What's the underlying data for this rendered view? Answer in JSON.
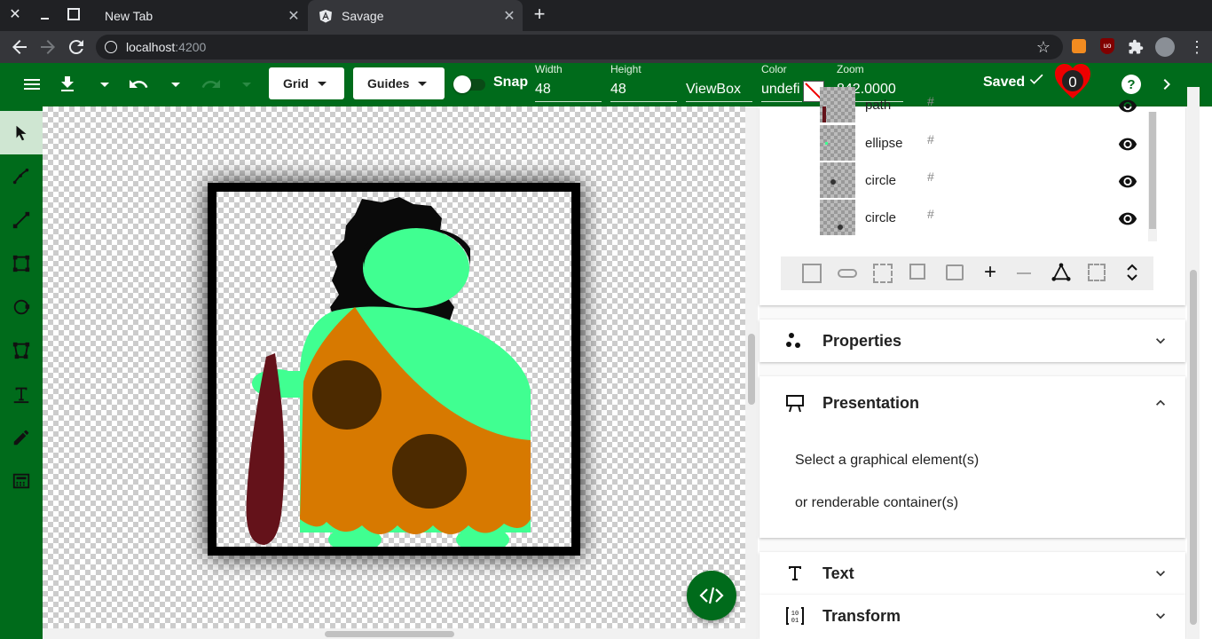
{
  "browser": {
    "tabs": [
      {
        "title": "New Tab"
      },
      {
        "title": "Savage"
      }
    ],
    "url_host": "localhost",
    "url_port": ":4200"
  },
  "toolbar": {
    "grid_label": "Grid",
    "guides_label": "Guides",
    "snap_label": "Snap",
    "width_label": "Width",
    "width_value": "48",
    "height_label": "Height",
    "height_value": "48",
    "viewbox_label": "ViewBox",
    "color_label": "Color",
    "color_value": "undefi",
    "zoom_label": "Zoom",
    "zoom_value": "842.0000",
    "saved_label": "Saved",
    "error_count": "0"
  },
  "layers": {
    "items": [
      {
        "name": "path",
        "id": "#"
      },
      {
        "name": "ellipse",
        "id": "#"
      },
      {
        "name": "circle",
        "id": "#"
      },
      {
        "name": "circle",
        "id": "#"
      }
    ]
  },
  "sections": {
    "properties": "Properties",
    "presentation": "Presentation",
    "presentation_msg1": "Select a graphical element(s)",
    "presentation_msg2": "or renderable container(s)",
    "text": "Text",
    "transform": "Transform"
  },
  "colors": {
    "brand": "#006b1b",
    "skin": "#40ff91",
    "tunic": "#d77900",
    "spots": "#4c2a00",
    "club": "#64121a",
    "hair": "#0a0a0a"
  }
}
